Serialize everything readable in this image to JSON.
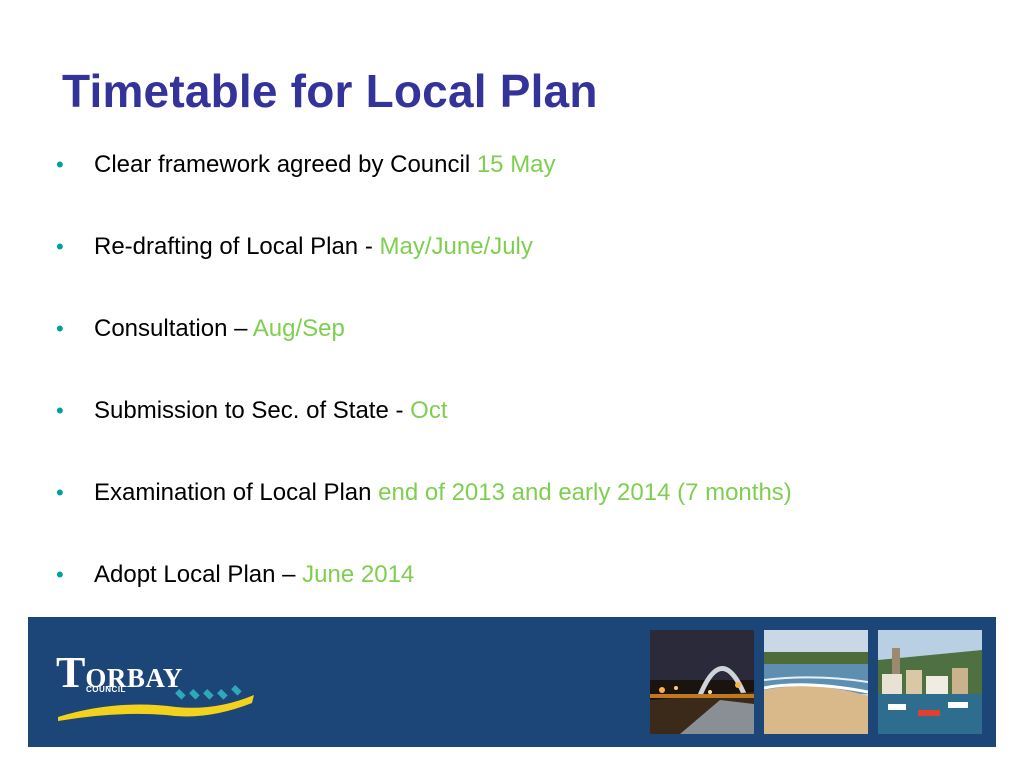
{
  "title": "Timetable for Local Plan",
  "bullets": [
    {
      "text": "Clear framework agreed by Council ",
      "highlight": "15 May"
    },
    {
      "text": "Re-drafting of Local Plan - ",
      "highlight": "May/June/July"
    },
    {
      "text": "Consultation – ",
      "highlight": "Aug/Sep"
    },
    {
      "text": "Submission to Sec. of State - ",
      "highlight": "Oct"
    },
    {
      "text": "Examination of Local Plan ",
      "highlight": "end of 2013 and early 2014 (7 months)"
    },
    {
      "text": "Adopt Local Plan – ",
      "highlight": "June 2014"
    }
  ],
  "bullet_glyph": "•",
  "footer": {
    "logo": {
      "initial": "T",
      "rest": "ORBAY",
      "sub": "COUNCIL"
    },
    "photos": [
      "night-harbour-walkway-photo",
      "beach-bay-photo",
      "harbour-town-photo"
    ]
  },
  "colors": {
    "title": "#333399",
    "highlight": "#7ecf4f",
    "bullet": "#00a0a0",
    "footer_band": "#1c4677"
  }
}
